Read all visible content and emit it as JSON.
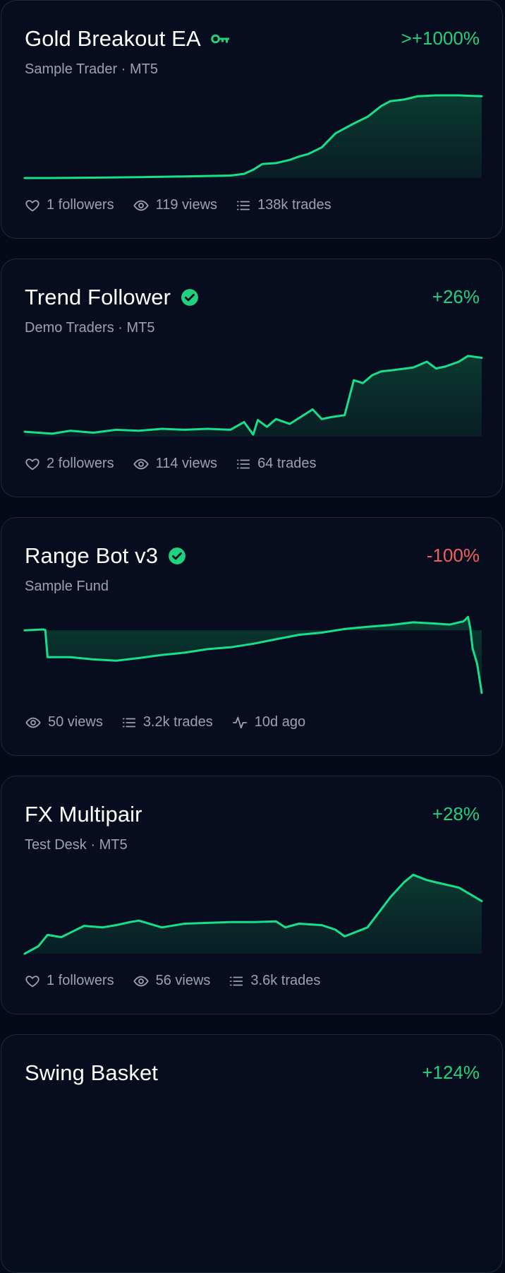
{
  "colors": {
    "positive": "#22d17e",
    "negative": "#f0605c",
    "muted": "#98a2b3",
    "line": "#17e08a",
    "fill": "#0b3a30"
  },
  "cards": [
    {
      "title": "Gold Breakout EA",
      "badge": "key-icon",
      "subtitle": "Sample Trader · MT5",
      "return_label": ">+1000%",
      "return_sign": "positive",
      "stats": [
        {
          "icon": "heart-icon",
          "text": "1 followers"
        },
        {
          "icon": "eye-icon",
          "text": "119 views"
        },
        {
          "icon": "list-icon",
          "text": "138k trades"
        }
      ]
    },
    {
      "title": "Trend Follower",
      "badge": "verified-icon",
      "subtitle": "Demo Traders · MT5",
      "return_label": "+26%",
      "return_sign": "positive",
      "stats": [
        {
          "icon": "heart-icon",
          "text": "2 followers"
        },
        {
          "icon": "eye-icon",
          "text": "114 views"
        },
        {
          "icon": "list-icon",
          "text": "64 trades"
        }
      ]
    },
    {
      "title": "Range Bot v3",
      "badge": "verified-icon",
      "subtitle": "Sample Fund",
      "return_label": "-100%",
      "return_sign": "negative",
      "stats": [
        {
          "icon": "eye-icon",
          "text": "50 views"
        },
        {
          "icon": "list-icon",
          "text": "3.2k trades"
        },
        {
          "icon": "activity-icon",
          "text": "10d ago"
        }
      ]
    },
    {
      "title": "FX Multipair",
      "badge": "",
      "subtitle": "Test Desk · MT5",
      "return_label": "+28%",
      "return_sign": "positive",
      "stats": [
        {
          "icon": "heart-icon",
          "text": "1 followers"
        },
        {
          "icon": "eye-icon",
          "text": "56 views"
        },
        {
          "icon": "list-icon",
          "text": "3.6k trades"
        }
      ]
    },
    {
      "title": "Swing Basket",
      "badge": "",
      "subtitle": "",
      "return_label": "+124%",
      "return_sign": "positive",
      "stats": []
    }
  ],
  "chart_data": [
    {
      "type": "area",
      "title": "",
      "xlabel": "",
      "ylabel": "",
      "x": [
        0,
        0.05,
        0.1,
        0.15,
        0.2,
        0.25,
        0.3,
        0.35,
        0.4,
        0.45,
        0.48,
        0.5,
        0.52,
        0.55,
        0.58,
        0.6,
        0.62,
        0.65,
        0.68,
        0.7,
        0.72,
        0.75,
        0.78,
        0.8,
        0.83,
        0.86,
        0.9,
        0.95,
        1
      ],
      "values": [
        0,
        0,
        0.2,
        0.4,
        0.8,
        1,
        1.5,
        2,
        2.5,
        3,
        5,
        10,
        17,
        18,
        22,
        26,
        29,
        37,
        54,
        60,
        66,
        74,
        87,
        93,
        95,
        99,
        100,
        100,
        99
      ],
      "ylim": [
        0,
        100
      ],
      "baseline": 0
    },
    {
      "type": "area",
      "title": "",
      "xlabel": "",
      "ylabel": "",
      "x": [
        0,
        0.03,
        0.06,
        0.1,
        0.15,
        0.2,
        0.25,
        0.3,
        0.35,
        0.4,
        0.45,
        0.48,
        0.5,
        0.51,
        0.53,
        0.55,
        0.58,
        0.62,
        0.63,
        0.65,
        0.67,
        0.7,
        0.72,
        0.74,
        0.76,
        0.78,
        0.8,
        0.85,
        0.88,
        0.9,
        0.92,
        0.95,
        0.97,
        1
      ],
      "values": [
        0,
        -1,
        -2,
        1,
        -1,
        2,
        1,
        3,
        2,
        3,
        2,
        10,
        -3,
        12,
        5,
        13,
        8,
        20,
        23,
        13,
        15,
        17,
        53,
        50,
        58,
        62,
        63,
        66,
        72,
        65,
        67,
        72,
        78,
        76
      ],
      "ylim": [
        -5,
        80
      ],
      "baseline": -5
    },
    {
      "type": "area",
      "title": "",
      "xlabel": "",
      "ylabel": "",
      "x": [
        0,
        0.04,
        0.045,
        0.05,
        0.1,
        0.15,
        0.2,
        0.25,
        0.3,
        0.35,
        0.4,
        0.45,
        0.5,
        0.55,
        0.6,
        0.65,
        0.7,
        0.75,
        0.8,
        0.85,
        0.9,
        0.93,
        0.96,
        0.97,
        0.975,
        0.98,
        0.99,
        1
      ],
      "values": [
        -100,
        -98,
        -99,
        -160,
        -160,
        -165,
        -168,
        -162,
        -155,
        -150,
        -142,
        -138,
        -130,
        -120,
        -110,
        -105,
        -97,
        -92,
        -88,
        -82,
        -85,
        -87,
        -80,
        -70,
        -95,
        -140,
        -175,
        -240
      ],
      "ylim": [
        -245,
        -60
      ],
      "baseline": -100
    },
    {
      "type": "area",
      "title": "",
      "xlabel": "",
      "ylabel": "",
      "x": [
        0,
        0.03,
        0.05,
        0.08,
        0.1,
        0.13,
        0.17,
        0.2,
        0.23,
        0.25,
        0.3,
        0.35,
        0.4,
        0.45,
        0.5,
        0.55,
        0.57,
        0.6,
        0.65,
        0.68,
        0.7,
        0.75,
        0.8,
        0.83,
        0.85,
        0.88,
        0.9,
        0.95,
        1
      ],
      "values": [
        0,
        10,
        25,
        22,
        28,
        37,
        35,
        38,
        42,
        44,
        35,
        40,
        41,
        42,
        42,
        43,
        35,
        40,
        38,
        32,
        23,
        35,
        75,
        95,
        105,
        98,
        95,
        88,
        70
      ],
      "ylim": [
        0,
        110
      ],
      "baseline": 0
    }
  ]
}
